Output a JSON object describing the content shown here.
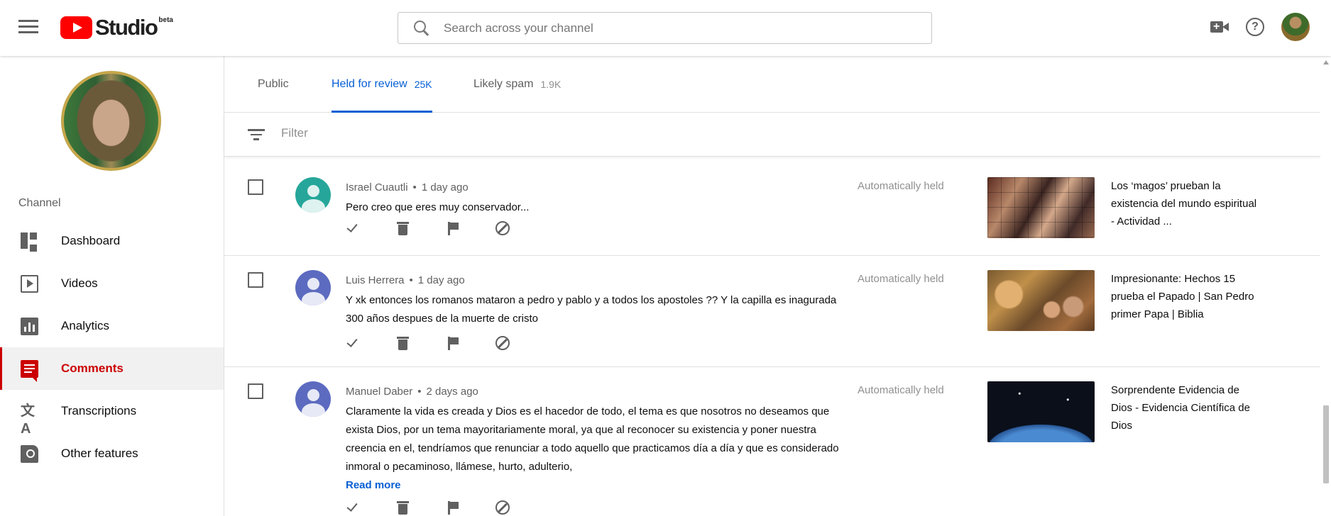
{
  "header": {
    "studio_label": "Studio",
    "beta_label": "beta",
    "search_placeholder": "Search across your channel"
  },
  "sidebar": {
    "section_label": "Channel",
    "items": [
      {
        "label": "Dashboard",
        "icon": "dashboard-icon"
      },
      {
        "label": "Videos",
        "icon": "videos-icon"
      },
      {
        "label": "Analytics",
        "icon": "analytics-icon"
      },
      {
        "label": "Comments",
        "icon": "comments-icon",
        "active": true
      },
      {
        "label": "Transcriptions",
        "icon": "transcriptions-icon"
      },
      {
        "label": "Other features",
        "icon": "other-features-icon"
      }
    ]
  },
  "tabs": [
    {
      "label": "Public",
      "count": ""
    },
    {
      "label": "Held for review",
      "count": "25K",
      "active": true
    },
    {
      "label": "Likely spam",
      "count": "1.9K"
    }
  ],
  "filter": {
    "placeholder": "Filter"
  },
  "comments": [
    {
      "author": "Israel Cuautli",
      "time": "1 day ago",
      "text": "Pero creo que eres muy conservador...",
      "status": "Automatically held",
      "avatar_color": "#26a69a",
      "video_title": "Los ‘magos’ prueban la existencia del mundo espiritual - Actividad ..."
    },
    {
      "author": "Luis Herrera",
      "time": "1 day ago",
      "text": "Y xk entonces los romanos mataron a pedro y pablo y a todos los apostoles ?? Y la capilla es inagurada 300 años despues de la muerte de cristo",
      "status": "Automatically held",
      "avatar_color": "#5c6bc0",
      "video_title": "Impresionante: Hechos 15 prueba el Papado | San Pedro primer Papa | Biblia"
    },
    {
      "author": "Manuel Daber",
      "time": "2 days ago",
      "text": "Claramente la vida es creada y Dios es el hacedor de todo, el tema es que nosotros no deseamos que exista Dios, por un tema mayoritariamente moral, ya que al reconocer su existencia y poner nuestra creencia en el, tendríamos que renunciar a todo aquello que practicamos día a día y que es considerado inmoral o pecaminoso, llámese, hurto, adulterio,",
      "read_more": "Read more",
      "status": "Automatically held",
      "avatar_color": "#5c6bc0",
      "video_title": "Sorprendente Evidencia de Dios - Evidencia Científica de Dios"
    }
  ],
  "colors": {
    "accent_red": "#cc0000",
    "brand_red": "#ff0000",
    "link_blue": "#065fd4"
  }
}
